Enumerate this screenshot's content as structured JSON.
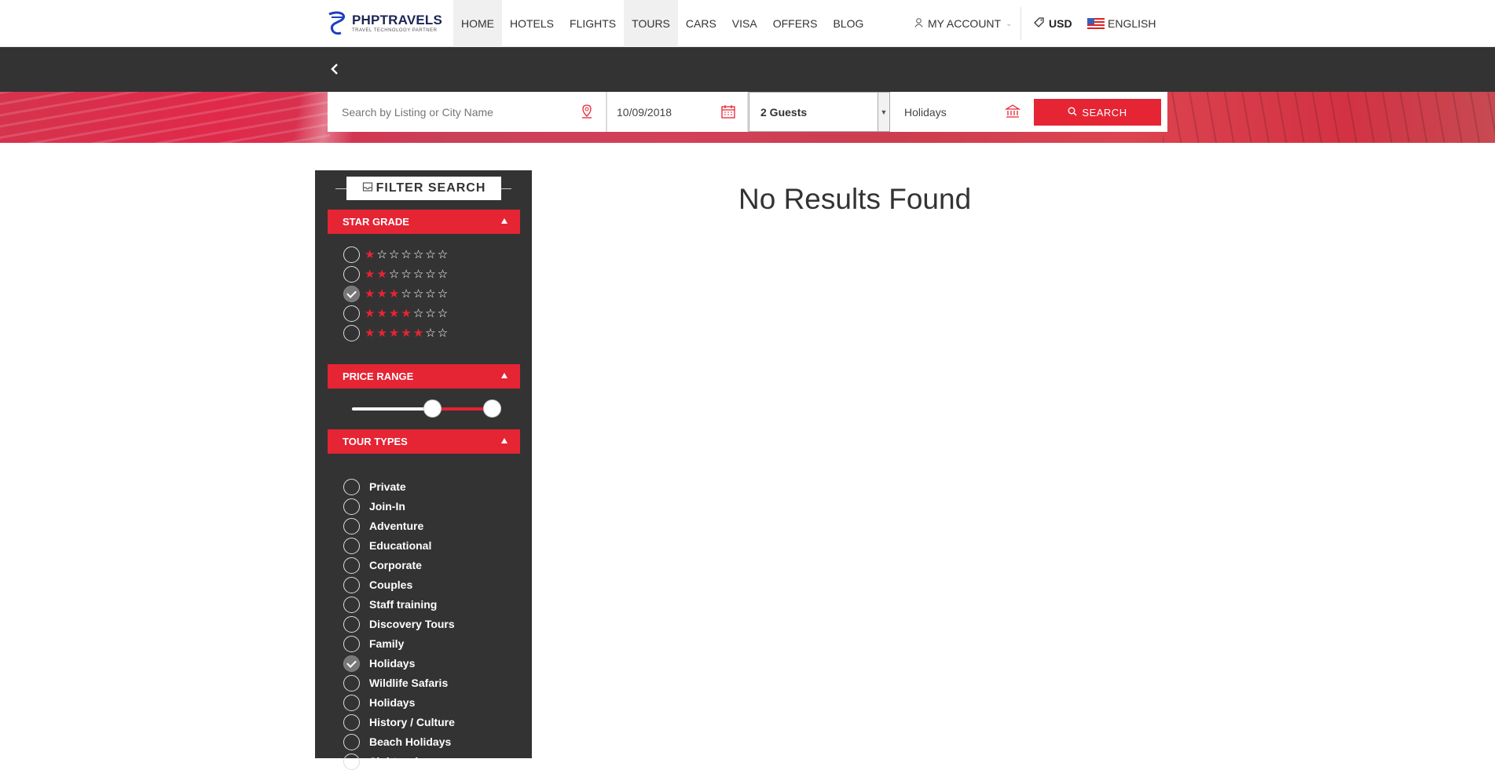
{
  "brand": {
    "name": "PHPTRAVELS",
    "tagline": "TRAVEL TECHNOLOGY PARTNER"
  },
  "nav": {
    "items": [
      {
        "label": "HOME"
      },
      {
        "label": "HOTELS"
      },
      {
        "label": "FLIGHTS"
      },
      {
        "label": "TOURS"
      },
      {
        "label": "CARS"
      },
      {
        "label": "VISA"
      },
      {
        "label": "OFFERS"
      },
      {
        "label": "BLOG"
      }
    ],
    "account_label": "MY ACCOUNT",
    "currency": "USD",
    "language": "ENGLISH"
  },
  "search": {
    "listing_placeholder": "Search by Listing or City Name",
    "date": "10/09/2018",
    "guests": "2 Guests",
    "tour_type": "Holidays",
    "button_label": "SEARCH"
  },
  "filters": {
    "title": "FILTER SEARCH",
    "star_grade_label": "STAR GRADE",
    "star_rows": [
      {
        "filled": 1,
        "checked": false
      },
      {
        "filled": 2,
        "checked": false
      },
      {
        "filled": 3,
        "checked": true
      },
      {
        "filled": 4,
        "checked": false
      },
      {
        "filled": 5,
        "checked": false
      }
    ],
    "star_total": 7,
    "price_range_label": "PRICE RANGE",
    "price_range": {
      "low_fraction": 0.55,
      "high_fraction": 0.96
    },
    "tour_types_label": "TOUR TYPES",
    "tour_types": [
      {
        "label": "Private",
        "checked": false
      },
      {
        "label": "Join-In",
        "checked": false
      },
      {
        "label": "Adventure",
        "checked": false
      },
      {
        "label": "Educational",
        "checked": false
      },
      {
        "label": "Corporate",
        "checked": false
      },
      {
        "label": "Couples",
        "checked": false
      },
      {
        "label": "Staff training",
        "checked": false
      },
      {
        "label": "Discovery Tours",
        "checked": false
      },
      {
        "label": "Family",
        "checked": false
      },
      {
        "label": "Holidays",
        "checked": true
      },
      {
        "label": "Wildlife Safaris",
        "checked": false
      },
      {
        "label": "Holidays",
        "checked": false
      },
      {
        "label": "History / Culture",
        "checked": false
      },
      {
        "label": "Beach Holidays",
        "checked": false
      },
      {
        "label": "Sightseeing",
        "checked": false
      }
    ]
  },
  "results": {
    "message": "No Results Found"
  },
  "colors": {
    "accent": "#e52434",
    "dark": "#333333",
    "brand": "#1b2654"
  }
}
